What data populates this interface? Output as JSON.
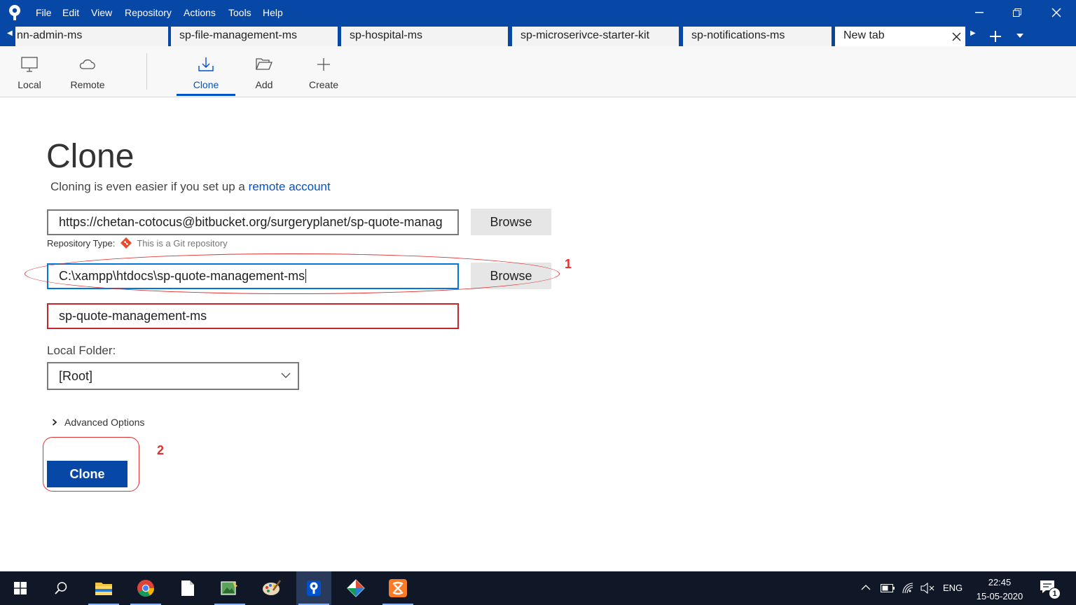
{
  "menu": [
    "File",
    "Edit",
    "View",
    "Repository",
    "Actions",
    "Tools",
    "Help"
  ],
  "tabs": [
    {
      "label": "nn-admin-ms"
    },
    {
      "label": "sp-file-management-ms"
    },
    {
      "label": "sp-hospital-ms"
    },
    {
      "label": "sp-microserivce-starter-kit"
    },
    {
      "label": "sp-notifications-ms"
    },
    {
      "label": "New tab"
    }
  ],
  "toolbar": {
    "local": "Local",
    "remote": "Remote",
    "clone": "Clone",
    "add": "Add",
    "create": "Create"
  },
  "main": {
    "title": "Clone",
    "subtitle_text": "Cloning is even easier if you set up a ",
    "subtitle_link": "remote account",
    "source_url": "https://chetan-cotocus@bitbucket.org/surgeryplanet/sp-quote-manag",
    "browse_label": "Browse",
    "repo_type_label": "Repository Type:",
    "repo_type_hint": "This is a Git repository",
    "destination_path": "C:\\xampp\\htdocs\\sp-quote-management-ms",
    "name": "sp-quote-management-ms",
    "local_folder_label": "Local Folder:",
    "local_folder_value": "[Root]",
    "advanced_options": "Advanced Options",
    "clone_button": "Clone"
  },
  "annotations": [
    "1",
    "2"
  ],
  "taskbar": {
    "language": "ENG",
    "time": "22:45",
    "date": "15-05-2020",
    "notification_count": "1"
  },
  "colors": {
    "brand": "#0747a6",
    "accent": "#0052cc",
    "annotation": "#e03030"
  }
}
